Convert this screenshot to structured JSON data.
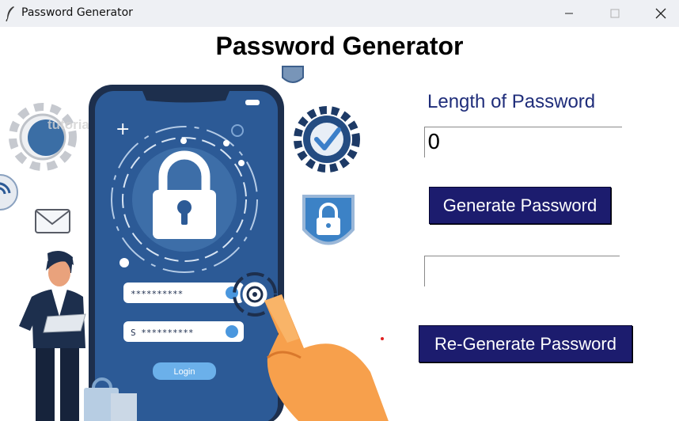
{
  "window": {
    "title": "Password Generator"
  },
  "heading": "Password Generator",
  "length_label": "Length of Password",
  "length_value": "0",
  "generated_password": "",
  "buttons": {
    "generate": "Generate Password",
    "regenerate": "Re-Generate Password"
  },
  "illustration": {
    "phone_field_1": "**********",
    "phone_field_2": "S **********",
    "phone_button": "Login",
    "watermark": "tutorialkart"
  },
  "colors": {
    "button_bg": "#1c1c6e",
    "label_color": "#1f2d7a",
    "phone_blue": "#2c5a96"
  }
}
